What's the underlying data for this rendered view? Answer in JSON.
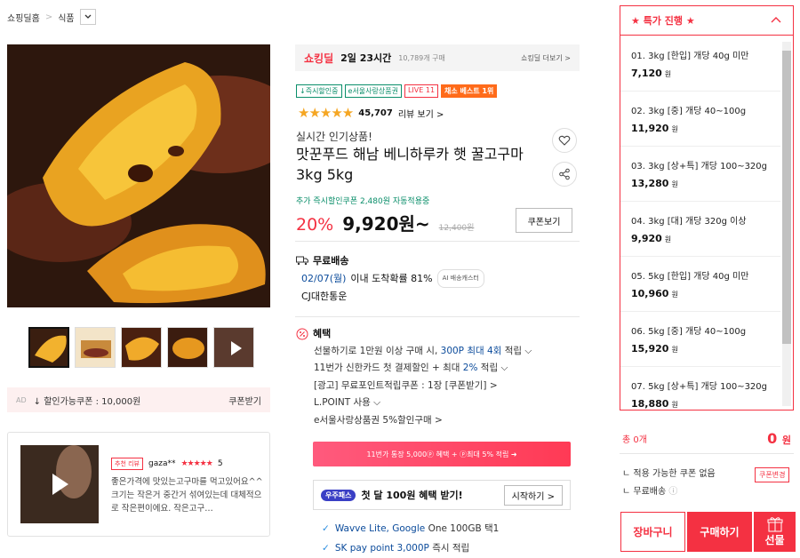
{
  "breadcrumb": {
    "home": "쇼핑딜홈",
    "separator": ">",
    "category": "식품"
  },
  "gallery": {
    "thumb_count": 5
  },
  "coupon_bar": {
    "ad": "AD",
    "text": "↓ 할인가능쿠폰 : 10,000원",
    "button": "쿠폰받기"
  },
  "review": {
    "tag": "추천 리뷰",
    "user": "gaza**",
    "stars": "★★★★★",
    "score": "5",
    "body": "좋은가격에 맛있는고구마를 먹고있어요^^ 크기는 작은거 중간거 섞여있는데 대체적으로 작은편이에요. 작은고구…"
  },
  "shopping_deal": {
    "logo": "쇼킹딜",
    "time_left": "2일 23시간",
    "count": "10,789개 구매",
    "more": "쇼킹딜 더보기 >"
  },
  "badges": [
    {
      "label": "↓즉시할인중",
      "style": "g"
    },
    {
      "label": "e서울사랑상품권",
      "style": "g"
    },
    {
      "label": "LIVE 11",
      "style": "r"
    },
    {
      "label": "채소 베스트 1위",
      "style": "o"
    }
  ],
  "rating": {
    "stars": "★★★★★",
    "count": "45,707",
    "label": "리뷰 보기 >"
  },
  "product": {
    "subtitle": "실시간 인기상품!",
    "title": "맛꾼푸드 해남 베니하루카 햇 꿀고구마 3kg 5kg",
    "extra_coupon": "추가 즉시할인쿠폰 2,480원 자동적용중",
    "discount": "20%",
    "price": "9,920원~",
    "original_price": "12,400원",
    "coupon_button": "쿠폰보기"
  },
  "shipping": {
    "header": "무료배송",
    "date": "02/07(월)",
    "arrive_text": "이내 도착확률 81%",
    "ai_badge": "AI 배송캐스터",
    "carrier": "CJ대한통운"
  },
  "benefits": {
    "header": "혜택",
    "line1_pre": "선물하기로 1만원 이상 구매 시,",
    "line1_blue": "300P 최대 4회",
    "line1_post": "적립",
    "line2_pre": "11번가 신한카드 첫 결제할인 + 최대",
    "line2_blue": "2%",
    "line2_post": "적립",
    "line3": "[광고] 무료포인트적립쿠폰 : 1장 [쿠폰받기] >",
    "line4": "L.POINT 사용",
    "line5": "e서울사랑상품권 5%할인구매 >"
  },
  "card_banner": "11번가 통장 5,000ⓟ 혜택 + ⓟ최대 5% 적립 ➜",
  "uzu": {
    "logo": "우주패스",
    "text": "첫 달 100원 혜택 받기!",
    "start": "시작하기 >"
  },
  "perks": [
    {
      "blue": "Wavve Lite, Google",
      "rest": "One 100GB 택1"
    },
    {
      "blue": "SK pay point 3,000P",
      "rest": "즉시 적립"
    }
  ],
  "options_panel": {
    "header": "★ 특가 진행 ★",
    "items": [
      {
        "name": "01. 3kg [한입] 개당 40g 미만",
        "price": "7,120",
        "unit": "원"
      },
      {
        "name": "02. 3kg [중] 개당 40~100g",
        "price": "11,920",
        "unit": "원"
      },
      {
        "name": "03. 3kg [상+특] 개당 100~320g",
        "price": "13,280",
        "unit": "원"
      },
      {
        "name": "04. 3kg [대] 개당 320g 이상",
        "price": "9,920",
        "unit": "원"
      },
      {
        "name": "05. 5kg [한입] 개당 40g 미만",
        "price": "10,960",
        "unit": "원"
      },
      {
        "name": "06. 5kg [중] 개당 40~100g",
        "price": "15,920",
        "unit": "원"
      },
      {
        "name": "07. 5kg [상+특] 개당 100~320g",
        "price": "18,880",
        "unit": "원"
      }
    ]
  },
  "summary": {
    "count": "총 0개",
    "total": "0",
    "total_unit": "원",
    "no_coupon": "적용 가능한 쿠폰 없음",
    "coupon_change": "쿠폰변경",
    "free_ship": "무료배송"
  },
  "actions": {
    "cart": "장바구니",
    "buy": "구매하기",
    "gift": "선물"
  },
  "colors": {
    "accent": "#f43142",
    "green": "#0a8e6a",
    "blue": "#0b4b9b"
  }
}
